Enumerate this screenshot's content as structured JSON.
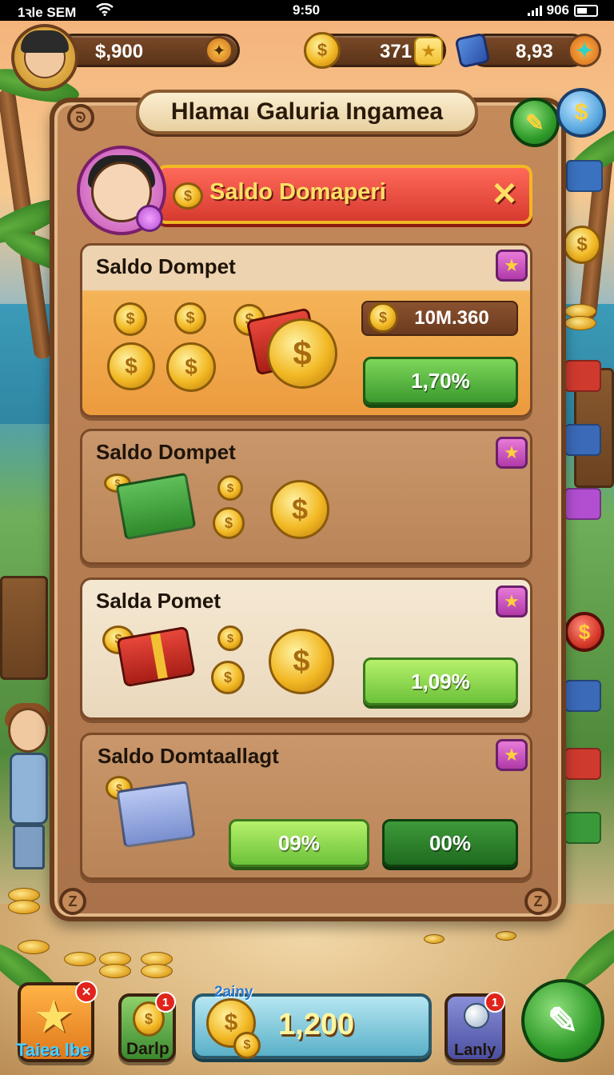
{
  "status_bar": {
    "left": "1ꝛle SEM",
    "time": "9:50",
    "right": "906"
  },
  "hud": {
    "currency_1": "$,900",
    "currency_2": "371",
    "currency_3": "8,93"
  },
  "panel": {
    "title": "Hlamaı Galuria Ingamea",
    "wallet_bar_label": "Saldo Domaperi",
    "close_symbol": "✕"
  },
  "cards": [
    {
      "title": "Saldo Dompet",
      "amount": "10M.360",
      "percent": "1,70%"
    },
    {
      "title": "Saldo Dompet"
    },
    {
      "title": "Salda Pomet",
      "percent": "1,09%"
    },
    {
      "title": "Saldo Domtaallagt",
      "percent_left": "09%",
      "percent_right": "00%"
    }
  ],
  "bottom_bar": {
    "left_tile_label": "Taiea lbe",
    "second_tile_label": "Darlp",
    "second_tile_badge": "1",
    "balance_tag": "2ainy",
    "balance_value": "1,200",
    "fourth_tile_label": "Lanly",
    "fourth_tile_badge": "1",
    "left_tile_close": "✕"
  },
  "icons": {
    "star": "★",
    "plus": "✦",
    "dollar": "$"
  },
  "colors": {
    "wallet_bar": "#d63a2e",
    "card_highlight": "#f0a84a",
    "card_neutral": "#c4946a",
    "card_light": "#f2e4cc",
    "progress_green": "#6cc23a"
  }
}
